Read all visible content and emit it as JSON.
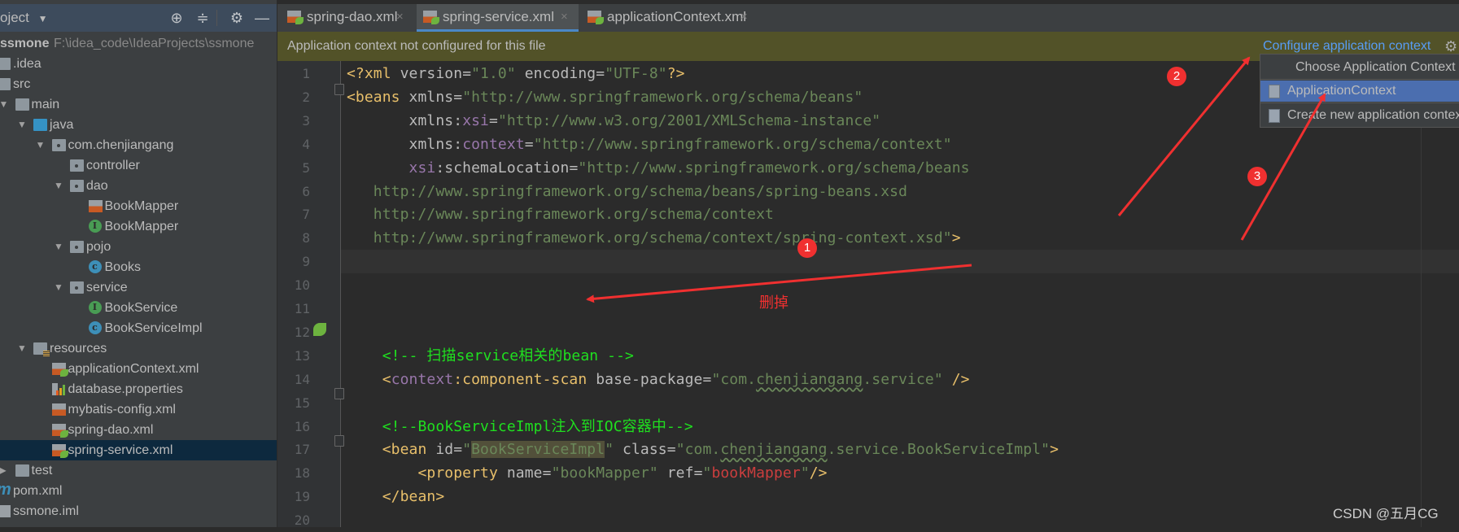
{
  "sidebar": {
    "title": "oject",
    "title_dropdown_icon": "caret-down",
    "header_icons": [
      "crosshair-icon",
      "collapse-all-icon",
      "gear-icon",
      "minimize-icon"
    ],
    "root": {
      "label": "ssmone",
      "path": "F:\\idea_code\\IdeaProjects\\ssmone"
    },
    "tree": [
      {
        "label": ".idea",
        "level": 0,
        "icon": "folder",
        "arrow": "none"
      },
      {
        "label": "src",
        "level": 0,
        "icon": "folder",
        "arrow": "none"
      },
      {
        "label": "main",
        "level": 1,
        "icon": "folder",
        "arrow": "open"
      },
      {
        "label": "java",
        "level": 2,
        "icon": "folder-blue",
        "arrow": "open"
      },
      {
        "label": "com.chenjiangang",
        "level": 3,
        "icon": "package",
        "arrow": "open"
      },
      {
        "label": "controller",
        "level": 4,
        "icon": "package",
        "arrow": "none"
      },
      {
        "label": "dao",
        "level": 4,
        "icon": "package",
        "arrow": "open"
      },
      {
        "label": "BookMapper",
        "level": 5,
        "icon": "xml",
        "arrow": "none"
      },
      {
        "label": "BookMapper",
        "level": 5,
        "icon": "interface",
        "arrow": "none"
      },
      {
        "label": "pojo",
        "level": 4,
        "icon": "package",
        "arrow": "open"
      },
      {
        "label": "Books",
        "level": 5,
        "icon": "class",
        "arrow": "none"
      },
      {
        "label": "service",
        "level": 4,
        "icon": "package",
        "arrow": "open"
      },
      {
        "label": "BookService",
        "level": 5,
        "icon": "interface",
        "arrow": "none"
      },
      {
        "label": "BookServiceImpl",
        "level": 5,
        "icon": "class",
        "arrow": "none"
      },
      {
        "label": "resources",
        "level": 2,
        "icon": "resources-folder",
        "arrow": "open"
      },
      {
        "label": "applicationContext.xml",
        "level": 3,
        "icon": "spring-xml",
        "arrow": "none"
      },
      {
        "label": "database.properties",
        "level": 3,
        "icon": "properties",
        "arrow": "none"
      },
      {
        "label": "mybatis-config.xml",
        "level": 3,
        "icon": "xml",
        "arrow": "none"
      },
      {
        "label": "spring-dao.xml",
        "level": 3,
        "icon": "spring-xml",
        "arrow": "none"
      },
      {
        "label": "spring-service.xml",
        "level": 3,
        "icon": "spring-xml",
        "arrow": "none",
        "selected": true
      },
      {
        "label": "test",
        "level": 1,
        "icon": "folder",
        "arrow": "closed"
      },
      {
        "label": "pom.xml",
        "level": 0,
        "icon": "maven",
        "arrow": "none"
      },
      {
        "label": "ssmone.iml",
        "level": 0,
        "icon": "iml",
        "arrow": "none"
      }
    ]
  },
  "tabs": [
    {
      "label": "spring-dao.xml",
      "active": false,
      "close": "×"
    },
    {
      "label": "spring-service.xml",
      "active": true,
      "close": "×"
    },
    {
      "label": "applicationContext.xml",
      "active": false,
      "close": "×"
    }
  ],
  "banner": {
    "message": "Application context not configured for this file",
    "link": "Configure application context",
    "gear_icon": "gear-icon"
  },
  "popup": {
    "header": "Choose Application Context",
    "items": [
      {
        "label": "ApplicationContext",
        "highlighted": true
      },
      {
        "label": "Create new application context...",
        "highlighted": false
      }
    ]
  },
  "editor": {
    "current_line": 9,
    "lines": [
      [
        [
          "tag",
          "<?xml"
        ],
        [
          "attr",
          " version"
        ],
        [
          "p",
          "="
        ],
        [
          "val",
          "\"1.0\""
        ],
        [
          "attr",
          " encoding"
        ],
        [
          "p",
          "="
        ],
        [
          "val",
          "\"UTF-8\""
        ],
        [
          "tag",
          "?>"
        ]
      ],
      [
        [
          "tag",
          "<beans"
        ],
        [
          "attr",
          " xmlns"
        ],
        [
          "p",
          "="
        ],
        [
          "val",
          "\"http://www.springframework.org/schema/beans\""
        ]
      ],
      [
        [
          "attr",
          "       xmlns:"
        ],
        [
          "ns",
          "xsi"
        ],
        [
          "p",
          "="
        ],
        [
          "val",
          "\"http://www.w3.org/2001/XMLSchema-instance\""
        ]
      ],
      [
        [
          "attr",
          "       xmlns:"
        ],
        [
          "ns",
          "context"
        ],
        [
          "p",
          "="
        ],
        [
          "val",
          "\"http://www.springframework.org/schema/context\""
        ]
      ],
      [
        [
          "ns",
          "       xsi"
        ],
        [
          "attr",
          ":schemaLocation"
        ],
        [
          "p",
          "="
        ],
        [
          "val",
          "\"http://www.springframework.org/schema/beans"
        ]
      ],
      [
        [
          "val",
          "   http://www.springframework.org/schema/beans/spring-beans.xsd"
        ]
      ],
      [
        [
          "val",
          "   http://www.springframework.org/schema/context"
        ]
      ],
      [
        [
          "val",
          "   http://www.springframework.org/schema/context/spring-context.xsd\""
        ],
        [
          "tag",
          ">"
        ]
      ],
      [],
      [],
      [],
      [],
      [
        [
          "cmt",
          "    <!-- 扫描service相关的bean -->"
        ]
      ],
      [
        [
          "tag",
          "    <"
        ],
        [
          "ns",
          "context"
        ],
        [
          "tag",
          ":component-scan"
        ],
        [
          "attr",
          " base-package"
        ],
        [
          "p",
          "="
        ],
        [
          "val",
          "\"com."
        ],
        [
          "valw",
          "chenjiangang"
        ],
        [
          "val",
          ".service\""
        ],
        [
          "tag",
          " />"
        ]
      ],
      [],
      [
        [
          "cmt",
          "    <!--BookServiceImpl注入到IOC容器中-->"
        ]
      ],
      [
        [
          "tag",
          "    <bean"
        ],
        [
          "attr",
          " id"
        ],
        [
          "p",
          "="
        ],
        [
          "val",
          "\""
        ],
        [
          "valh",
          "BookServiceImpl"
        ],
        [
          "val",
          "\""
        ],
        [
          "attr",
          " class"
        ],
        [
          "p",
          "="
        ],
        [
          "val",
          "\"com."
        ],
        [
          "valw",
          "chenjiangang"
        ],
        [
          "val",
          ".service.BookServiceImpl\""
        ],
        [
          "tag",
          ">"
        ]
      ],
      [
        [
          "tag",
          "        <property"
        ],
        [
          "attr",
          " name"
        ],
        [
          "p",
          "="
        ],
        [
          "val",
          "\"bookMapper\""
        ],
        [
          "attr",
          " ref"
        ],
        [
          "p",
          "="
        ],
        [
          "val",
          "\""
        ],
        [
          "ref",
          "bookMapper"
        ],
        [
          "val",
          "\""
        ],
        [
          "tag",
          "/>"
        ]
      ],
      [
        [
          "tag",
          "    </bean>"
        ]
      ],
      []
    ]
  },
  "annotations": {
    "badges": [
      "1",
      "2",
      "3"
    ],
    "delete_note": "删掉",
    "color": "#f03030"
  },
  "watermark": "CSDN @五月CG",
  "colors": {
    "accent": "#4a88c7",
    "link": "#589df6",
    "banner": "#525228",
    "selection": "#0d293e"
  }
}
